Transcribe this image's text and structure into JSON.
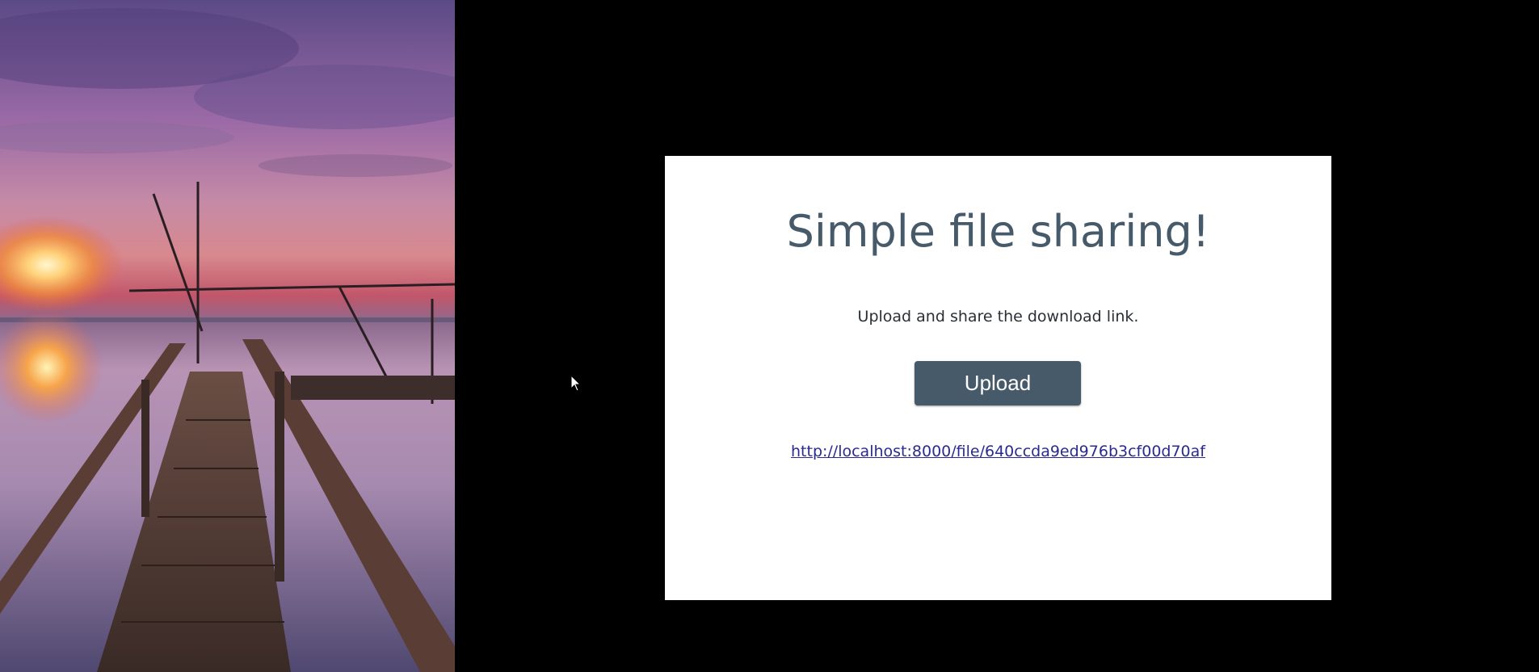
{
  "card": {
    "title": "Simple file sharing!",
    "subtitle": "Upload and share the download link.",
    "upload_label": "Upload",
    "download_link": "http://localhost:8000/file/640ccda9ed976b3cf00d70af"
  },
  "colors": {
    "accent": "#465a6a",
    "link": "#2a2a8f",
    "background": "#000000",
    "card": "#ffffff"
  },
  "icons": {
    "cursor": "mouse-pointer-icon"
  }
}
